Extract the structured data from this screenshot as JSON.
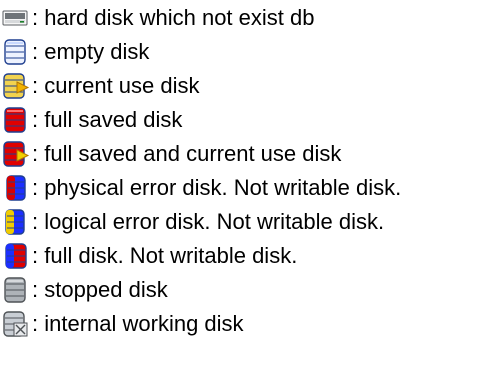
{
  "legend": {
    "items": [
      {
        "icon": "hard-disk-not-exist-db-icon",
        "label": ": hard disk which not exist db"
      },
      {
        "icon": "empty-disk-icon",
        "label": ": empty disk"
      },
      {
        "icon": "current-use-disk-icon",
        "label": ": current use disk"
      },
      {
        "icon": "full-saved-disk-icon",
        "label": ": full saved disk"
      },
      {
        "icon": "full-saved-current-use-disk-icon",
        "label": ": full saved and current use disk"
      },
      {
        "icon": "physical-error-disk-icon",
        "label": ": physical error disk. Not writable disk."
      },
      {
        "icon": "logical-error-disk-icon",
        "label": ": logical error disk. Not writable disk."
      },
      {
        "icon": "full-disk-icon",
        "label": ": full disk. Not writable disk."
      },
      {
        "icon": "stopped-disk-icon",
        "label": ": stopped disk"
      },
      {
        "icon": "internal-working-disk-icon",
        "label": ": internal working disk"
      }
    ]
  },
  "colors": {
    "text": "#000000",
    "background": "#ffffff",
    "disk_outline": "#1f3f8f",
    "empty_fill": "#eef3ff",
    "current_use_fill": "#f2d34f",
    "current_use_arrow": "#f2b300",
    "full_fill": "#e00000",
    "physical_error_fill": "#d80000",
    "logical_error_fill": "#f0cc00",
    "error_blue": "#1c2fff",
    "stopped_fill": "#aeb3b8",
    "internal_fill": "#c9ced4",
    "hard_disk_fill": "#6f7478"
  }
}
